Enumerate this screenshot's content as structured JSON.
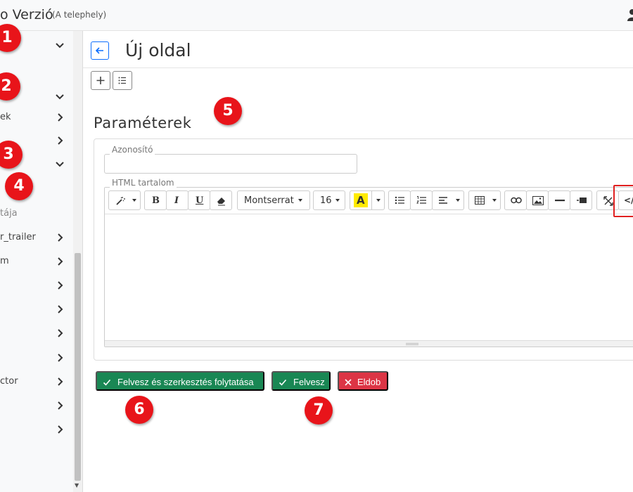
{
  "header": {
    "app_title": "o Verzió",
    "app_subtitle": "(A telephely)"
  },
  "sidebar": {
    "items": [
      {
        "label": "",
        "muted": false
      },
      {
        "label": "",
        "muted": false
      },
      {
        "label": "ek",
        "muted": false
      },
      {
        "label": "",
        "muted": false
      },
      {
        "label": "",
        "muted": false
      },
      {
        "label": "tája",
        "muted": true
      },
      {
        "label": "r_trailer",
        "muted": false
      },
      {
        "label": "m",
        "muted": false
      },
      {
        "label": "",
        "muted": false
      },
      {
        "label": "",
        "muted": false
      },
      {
        "label": "",
        "muted": false
      },
      {
        "label": "",
        "muted": false
      },
      {
        "label": "ctor",
        "muted": false
      },
      {
        "label": "",
        "muted": false
      },
      {
        "label": "",
        "muted": false
      }
    ]
  },
  "page": {
    "title": "Új oldal"
  },
  "form": {
    "section_title": "Paraméterek",
    "id_label": "Azonosító",
    "id_value": "",
    "html_label": "HTML tartalom",
    "font_name": "Montserrat",
    "font_size": "16",
    "code_label": "</>"
  },
  "actions": {
    "save_continue": "Felvesz és szerkesztés folytatása",
    "save": "Felvesz",
    "discard": "Eldob"
  },
  "badges": [
    "1",
    "2",
    "3",
    "4",
    "5",
    "6",
    "7"
  ],
  "colors": {
    "primary": "#0d6efd",
    "success": "#198754",
    "danger": "#dc3545",
    "badge": "#e8141a",
    "highlight_font_color": "#ffeb00"
  }
}
